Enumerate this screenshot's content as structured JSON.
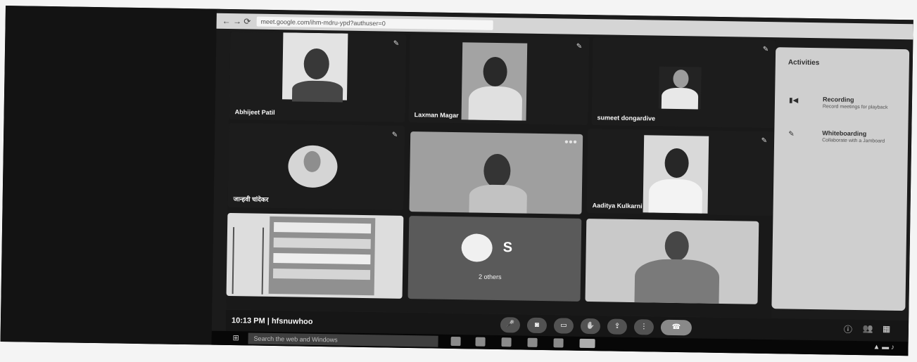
{
  "browser": {
    "nav_glyphs": "← → ⟳",
    "url": "meet.google.com/ihm-mdru-ypd?authuser=0"
  },
  "participants": [
    {
      "name": "Abhijeet Patil"
    },
    {
      "name": "Laxman Magar"
    },
    {
      "name": "sumeet dongardive"
    },
    {
      "name": "जान्हवी चांदेकर"
    },
    {
      "name": ""
    },
    {
      "name": "Aaditya Kulkarni"
    }
  ],
  "others": {
    "initial": "S",
    "label": "2 others"
  },
  "bottom_bar": {
    "time_and_code": "10:13 PM  |  hfsnuwhoo"
  },
  "activities": {
    "title": "Activities",
    "items": [
      {
        "label": "Recording",
        "desc": "Record meetings for playback"
      },
      {
        "label": "Whiteboarding",
        "desc": "Collaborate with a Jamboard"
      }
    ]
  },
  "taskbar": {
    "search_placeholder": "Search the web and Windows"
  }
}
